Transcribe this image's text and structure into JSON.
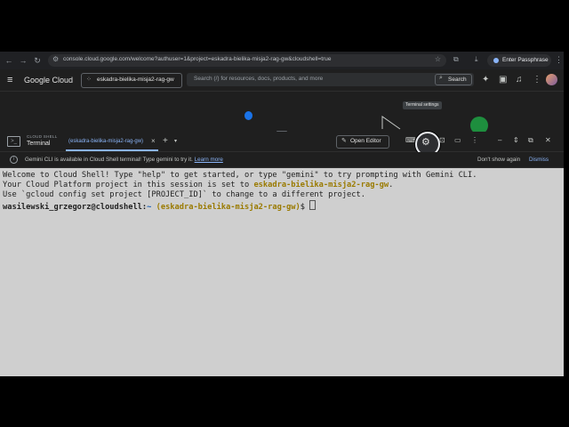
{
  "browser": {
    "url": "console.cloud.google.com/welcome?authuser=1&project=eskadra-bielika-misja2-rag-gw&cloudshell=true",
    "passphrase_label": "Enter Passphrase"
  },
  "console": {
    "logo": "Google Cloud",
    "project_name": "eskadra-bielika-misja2-rag-gw",
    "search_placeholder": "Search (/) for resources, docs, products, and more",
    "search_button": "Search"
  },
  "cloudshell": {
    "section_title": "CLOUD SHELL",
    "section_subtitle": "Terminal",
    "tab_label": "(eskadra-bielika-misja2-rag-gw)",
    "open_editor_label": "Open Editor",
    "tooltip": "Terminal settings"
  },
  "notice": {
    "text": "Gemini CLI is available in Cloud Shell terminal! Type gemini to try it.",
    "learn_more": "Learn more",
    "dont_show": "Don't show again",
    "dismiss": "Dismiss"
  },
  "terminal": {
    "line1": "Welcome to Cloud Shell! Type \"help\" to get started, or type \"gemini\" to try prompting with Gemini CLI.",
    "line2_prefix": "Your Cloud Platform project in this session is set to ",
    "line2_project": "eskadra-bielika-misja2-rag-gw",
    "line2_suffix": ".",
    "line3": "Use `gcloud config set project [PROJECT_ID]` to change to a different project.",
    "prompt_user": "wasilewski_grzegorz@cloudshell:",
    "prompt_path": "~ ",
    "prompt_project": "(eskadra-bielika-misja2-rag-gw)",
    "prompt_symbol": "$ "
  },
  "colors": {
    "accent": "#8ab4f8",
    "terminal_bg": "#cfcfcf",
    "project_highlight": "#9a7a00",
    "chrome_bg": "#1f1f1f"
  }
}
